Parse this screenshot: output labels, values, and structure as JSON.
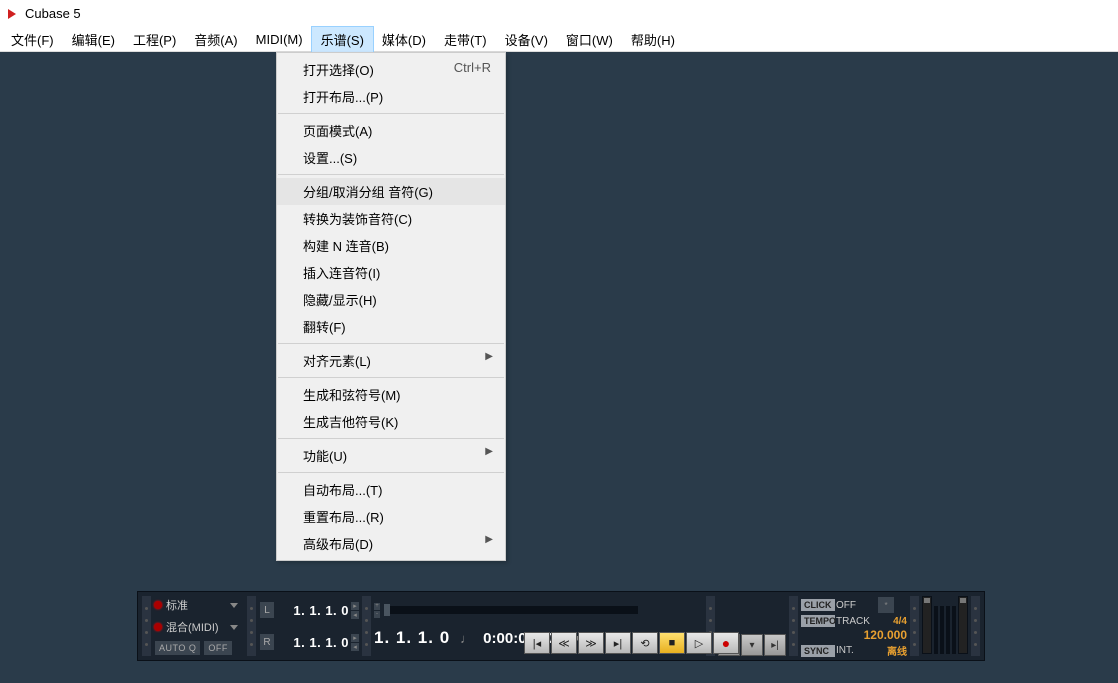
{
  "app": {
    "title": "Cubase 5"
  },
  "menubar": [
    "文件(F)",
    "编辑(E)",
    "工程(P)",
    "音频(A)",
    "MIDI(M)",
    "乐谱(S)",
    "媒体(D)",
    "走带(T)",
    "设备(V)",
    "窗口(W)",
    "帮助(H)"
  ],
  "activeMenuIndex": 5,
  "dropdown": [
    {
      "label": "打开选择(O)",
      "shortcut": "Ctrl+R"
    },
    {
      "label": "打开布局...(P)"
    },
    {
      "sep": true
    },
    {
      "label": "页面模式(A)"
    },
    {
      "label": "设置...(S)"
    },
    {
      "sep": true
    },
    {
      "label": "分组/取消分组 音符(G)",
      "hover": true
    },
    {
      "label": "转换为装饰音符(C)"
    },
    {
      "label": "构建 N 连音(B)"
    },
    {
      "label": "插入连音符(I)"
    },
    {
      "label": "隐藏/显示(H)"
    },
    {
      "label": "翻转(F)"
    },
    {
      "sep": true
    },
    {
      "label": "对齐元素(L)",
      "submenu": true
    },
    {
      "sep": true
    },
    {
      "label": "生成和弦符号(M)"
    },
    {
      "label": "生成吉他符号(K)"
    },
    {
      "sep": true
    },
    {
      "label": "功能(U)",
      "submenu": true
    },
    {
      "sep": true
    },
    {
      "label": "自动布局...(T)"
    },
    {
      "label": "重置布局...(R)"
    },
    {
      "label": "高级布局(D)",
      "submenu": true
    }
  ],
  "transport": {
    "mode1": "标准",
    "mode2": "混合(MIDI)",
    "autoq": "AUTO Q",
    "off": "OFF",
    "L": "L",
    "R": "R",
    "posL": "1. 1. 1.  0",
    "posR": "1. 1. 1.  0",
    "bigtime": "1. 1. 1.   0",
    "sectime": "0:00:00.000",
    "click": "CLICK",
    "click_v": "OFF",
    "tempo": "TEMPO",
    "tempo_v": "TRACK",
    "sig": "4/4",
    "bpm": "120.000",
    "sync": "SYNC",
    "sync_v": "INT.",
    "offline": "离线",
    "star": "*"
  }
}
